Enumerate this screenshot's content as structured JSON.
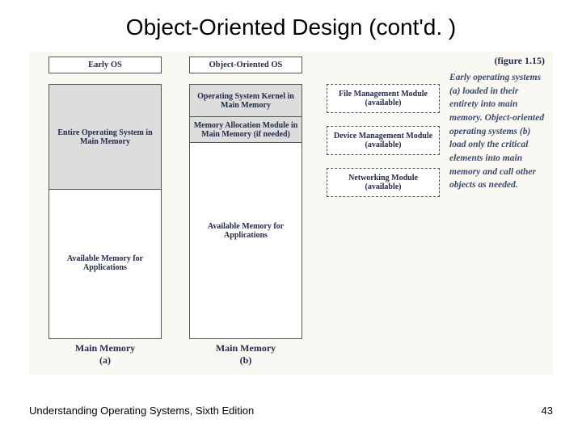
{
  "title": "Object-Oriented Design (cont'd. )",
  "figure": {
    "label": "(figure 1.15)",
    "description": "Early operating systems (a) loaded in their entirety into main memory. Object-oriented operating systems (b) load only the critical elements into main memory and call other objects as needed.",
    "colA": {
      "header": "Early OS",
      "loaded": "Entire Operating System in Main Memory",
      "available": "Available Memory for Applications",
      "caption_top": "Main Memory",
      "caption_bottom": "(a)"
    },
    "colB": {
      "header": "Object-Oriented OS",
      "kernel": "Operating System Kernel in Main Memory",
      "alloc": "Memory Allocation Module in Main Memory (if needed)",
      "available": "Available Memory for Applications",
      "caption_top": "Main Memory",
      "caption_bottom": "(b)"
    },
    "modules": {
      "file": "File Management Module (available)",
      "device": "Device Management Module (available)",
      "net": "Networking Module (available)"
    }
  },
  "footer": {
    "left": "Understanding Operating Systems, Sixth Edition",
    "page": "43"
  }
}
